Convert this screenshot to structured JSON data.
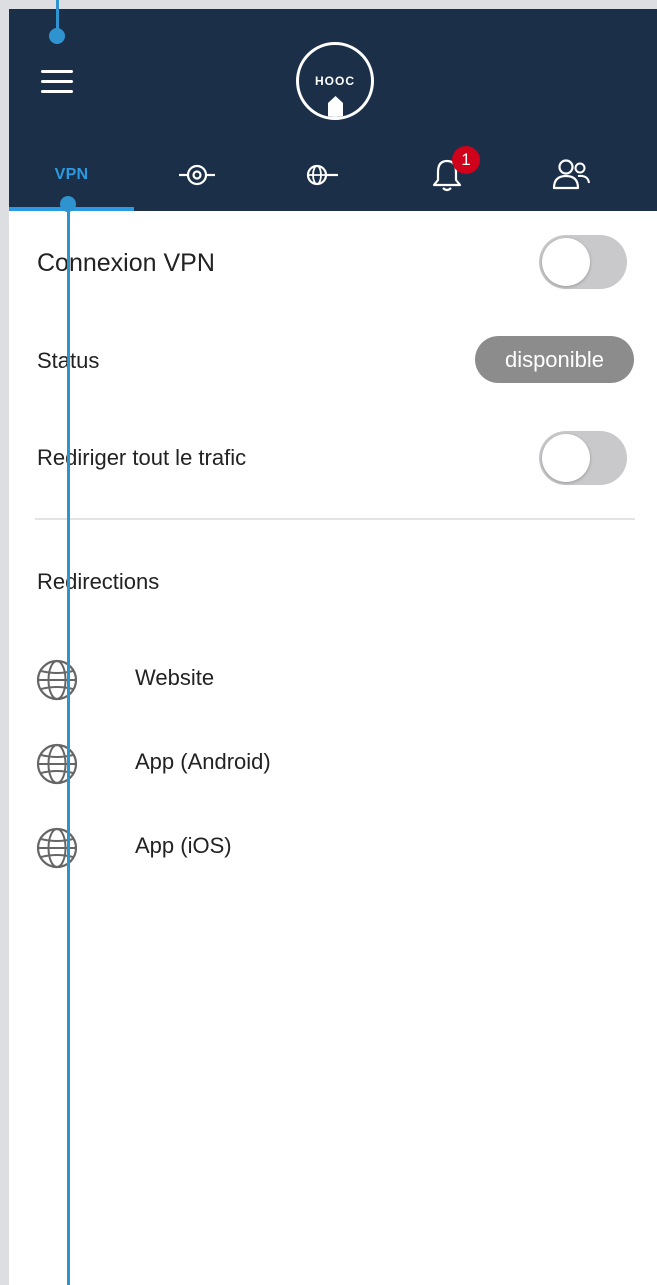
{
  "header": {
    "logo_text": "HOOC",
    "tabs": [
      {
        "label": "VPN",
        "icon": "vpn-text"
      },
      {
        "icon": "network-node-icon"
      },
      {
        "icon": "globe-connection-icon"
      },
      {
        "icon": "bell-icon",
        "badge": "1"
      },
      {
        "icon": "users-icon"
      }
    ]
  },
  "vpn": {
    "connection_label": "Connexion VPN",
    "connection_on": false,
    "status_label": "Status",
    "status_value": "disponible",
    "redirect_all_label": "Rediriger tout le trafic",
    "redirect_all_on": false
  },
  "redirections": {
    "title": "Redirections",
    "items": [
      {
        "label": "Website",
        "icon": "globe-icon"
      },
      {
        "label": "App (Android)",
        "icon": "globe-icon"
      },
      {
        "label": "App (iOS)",
        "icon": "globe-icon"
      }
    ]
  },
  "colors": {
    "header_bg": "#1b3048",
    "accent": "#2a9be3",
    "badge": "#d0021b",
    "annotation": "#2e93cf"
  }
}
